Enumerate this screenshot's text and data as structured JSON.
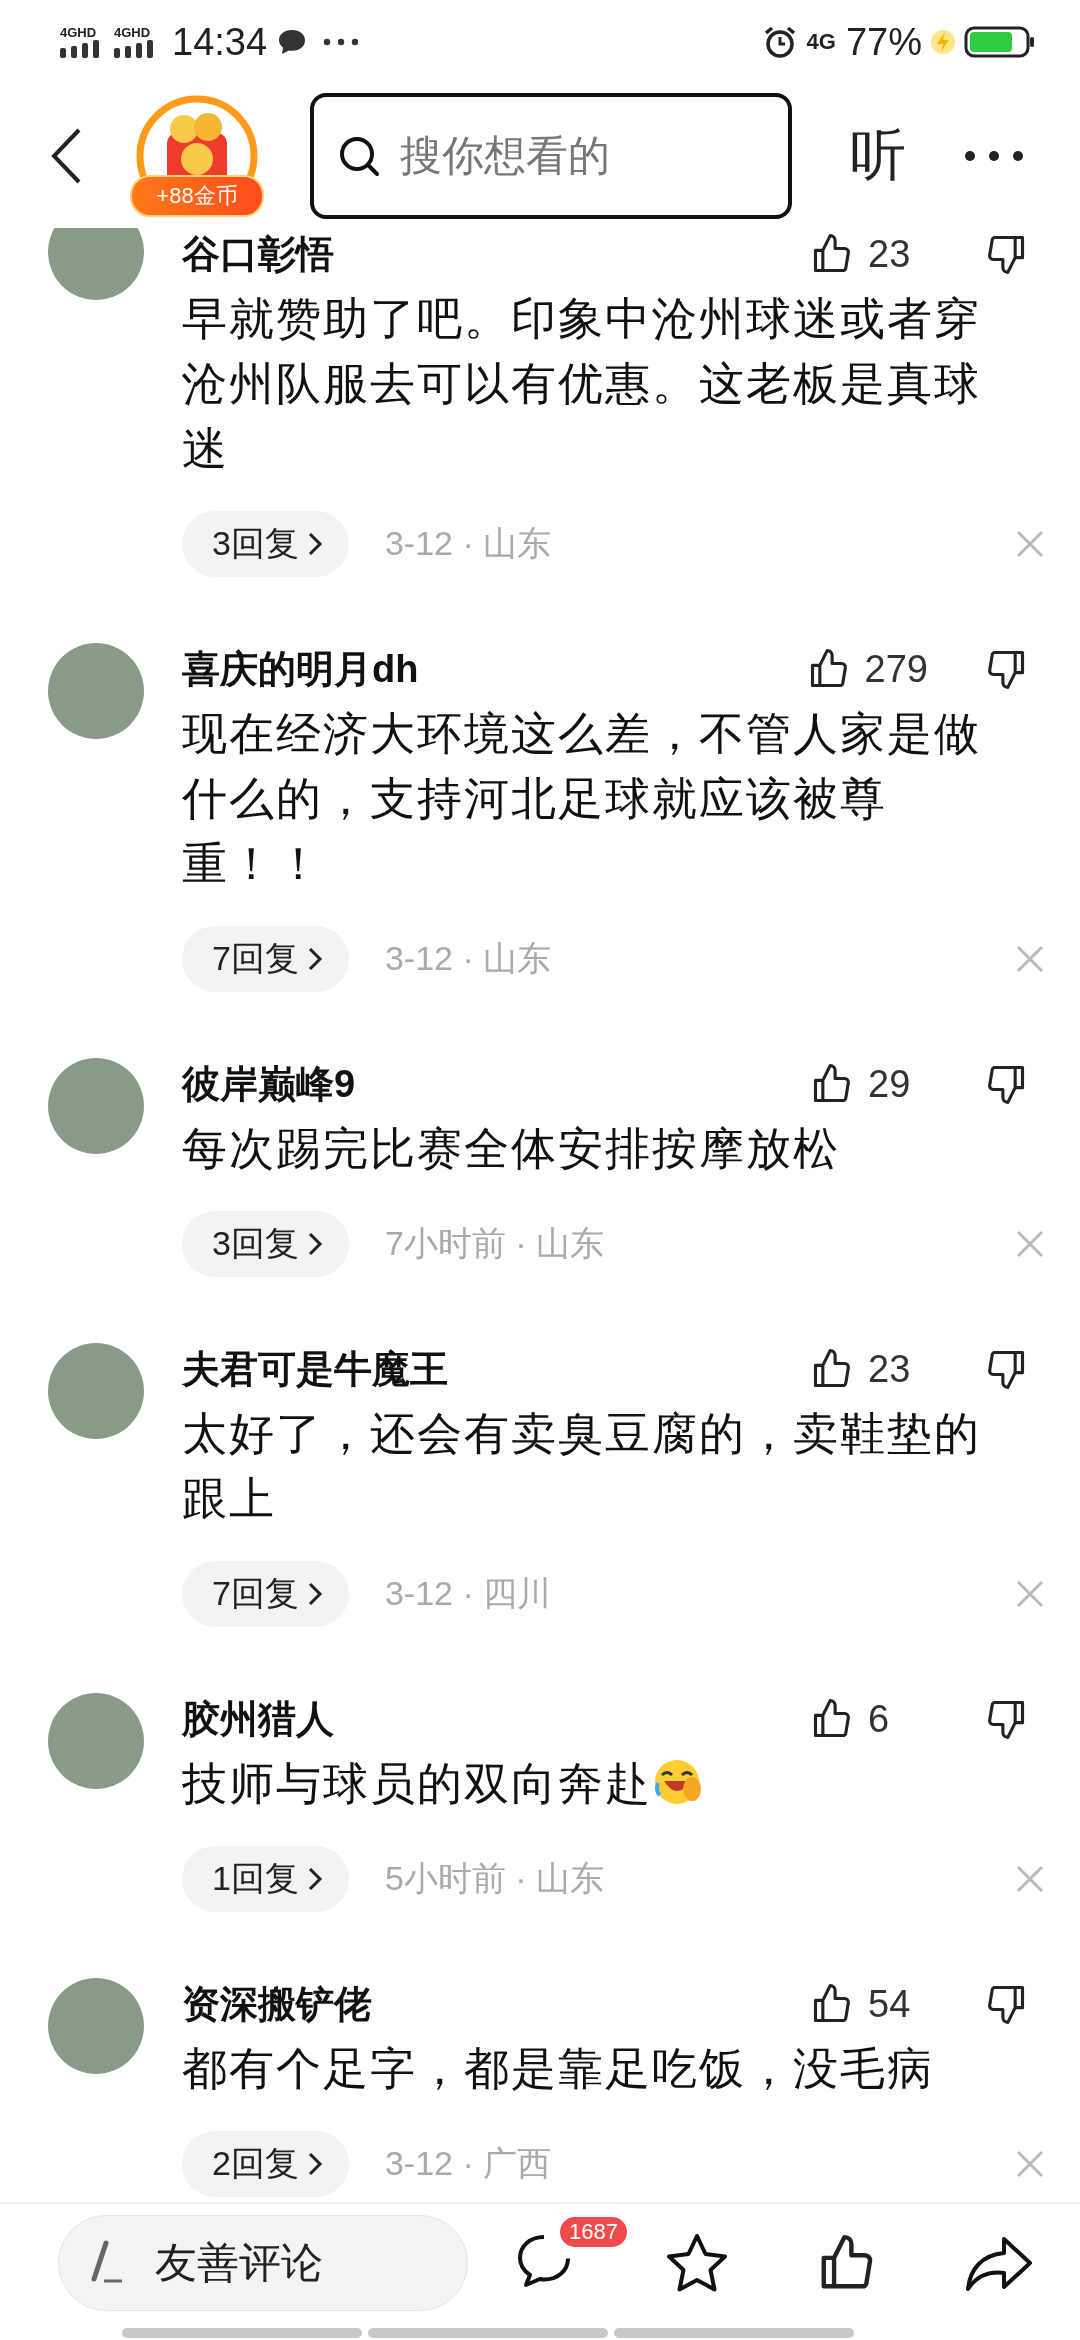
{
  "status_bar": {
    "signals": [
      "4GHD",
      "4GHD"
    ],
    "time": "14:34",
    "network": "4G",
    "battery": "77%"
  },
  "header": {
    "coin_badge": "+88金币",
    "search": {
      "placeholder": "搜你想看的"
    },
    "listen": "听"
  },
  "comments": [
    {
      "name": "谷口彰悟",
      "likes": "23",
      "text": "早就赞助了吧。印象中沧州球迷或者穿沧州队服去可以有优惠。这老板是真球迷",
      "replies": "3回复",
      "meta": "3-12 · 山东",
      "emoji": false
    },
    {
      "name": "喜庆的明月dh",
      "likes": "279",
      "text": "现在经济大环境这么差，不管人家是做什么的，支持河北足球就应该被尊重！！",
      "replies": "7回复",
      "meta": "3-12 · 山东",
      "emoji": false
    },
    {
      "name": "彼岸巅峰9",
      "likes": "29",
      "text": "每次踢完比赛全体安排按摩放松",
      "replies": "3回复",
      "meta": "7小时前 · 山东",
      "emoji": false
    },
    {
      "name": "夫君可是牛魔王",
      "likes": "23",
      "text": "太好了，还会有卖臭豆腐的，卖鞋垫的跟上",
      "replies": "7回复",
      "meta": "3-12 · 四川",
      "emoji": false
    },
    {
      "name": "胶州猎人",
      "likes": "6",
      "text": "技师与球员的双向奔赴",
      "replies": "1回复",
      "meta": "5小时前 · 山东",
      "emoji": true
    },
    {
      "name": "资深搬铲佬",
      "likes": "54",
      "text": "都有个足字，都是靠足吃饭，没毛病",
      "replies": "2回复",
      "meta": "3-12 · 广西",
      "emoji": false
    }
  ],
  "bottom_bar": {
    "comment_input": {
      "placeholder": "友善评论"
    },
    "comment_count": "1687"
  }
}
